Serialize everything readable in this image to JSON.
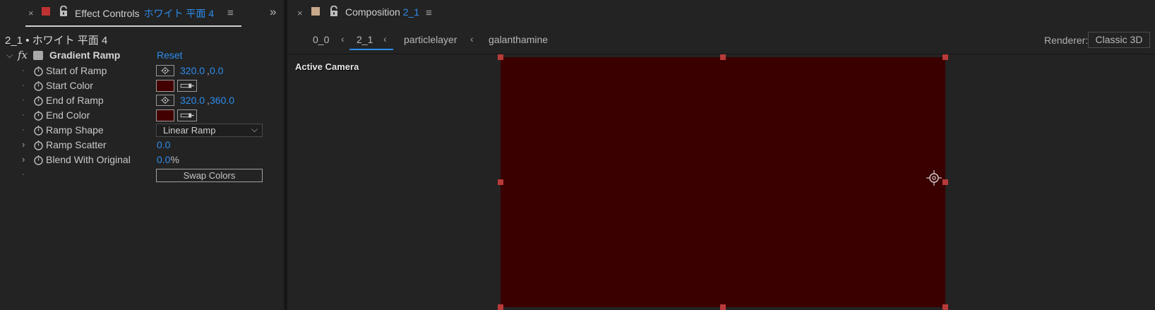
{
  "effect_controls": {
    "tab": {
      "close_glyph": "×",
      "swatch_color": "#c03232",
      "title": "Effect Controls",
      "layer_name": "ホワイト 平面 4",
      "menu_glyph": "≡",
      "expand_glyph": "»"
    },
    "layer_header": {
      "comp": "2_1",
      "bullet": "•",
      "layer": "ホワイト 平面 4"
    },
    "effect": {
      "fx_label": "fx",
      "name": "Gradient Ramp",
      "reset_label": "Reset"
    },
    "properties": {
      "start_of_ramp": {
        "label": "Start of Ramp",
        "x": "320.0",
        "y": "0.0"
      },
      "start_color": {
        "label": "Start Color",
        "color": "#430000"
      },
      "end_of_ramp": {
        "label": "End of Ramp",
        "x": "320.0",
        "y": "360.0"
      },
      "end_color": {
        "label": "End Color",
        "color": "#430000"
      },
      "ramp_shape": {
        "label": "Ramp Shape",
        "value": "Linear Ramp"
      },
      "ramp_scatter": {
        "label": "Ramp Scatter",
        "value": "0.0"
      },
      "blend_with_original": {
        "label": "Blend With Original",
        "value": "0.0",
        "unit": "%"
      }
    },
    "swap_colors_label": "Swap Colors"
  },
  "composition": {
    "tab": {
      "close_glyph": "×",
      "swatch_color": "#c8a98a",
      "title": "Composition",
      "comp_name": "2_1",
      "menu_glyph": "≡"
    },
    "breadcrumbs": {
      "items": [
        "0_0",
        "2_1",
        "particlelayer",
        "galanthamine"
      ],
      "active_index": 1
    },
    "renderer_label": "Renderer:",
    "renderer_value": "Classic 3D",
    "view_label": "Active Camera",
    "solid_color": "#3a0000",
    "handle_color": "#b83a3a"
  },
  "colors": {
    "accent_blue": "#2d8ceb",
    "panel_bg": "#232323"
  }
}
